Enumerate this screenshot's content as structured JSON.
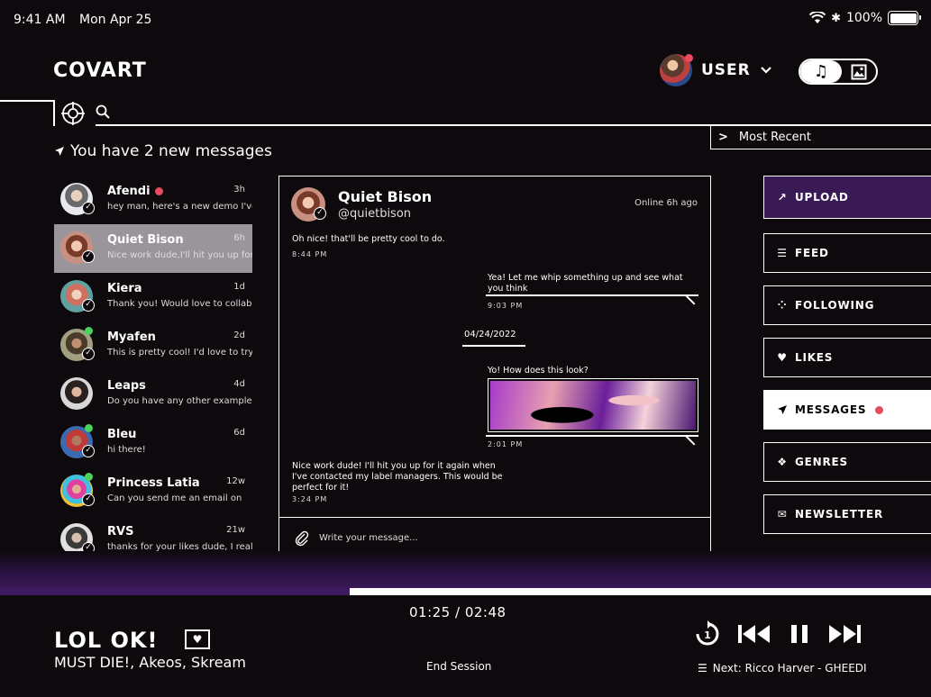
{
  "status_bar": {
    "time": "9:41 AM",
    "date": "Mon Apr 25",
    "battery": "100%"
  },
  "header": {
    "logo": "COVART",
    "user_label": "USER"
  },
  "search": {
    "placeholder": ""
  },
  "sort": {
    "label": "Most Recent"
  },
  "inbox": {
    "notice": "You have 2 new messages"
  },
  "conversations": [
    {
      "name": "Afendi",
      "time": "3h",
      "preview": "hey man, here's a new demo I've",
      "unread": true
    },
    {
      "name": "Quiet Bison",
      "time": "6h",
      "preview": "Nice work dude,I'll hit you up for",
      "active": true
    },
    {
      "name": "Kiera",
      "time": "1d",
      "preview": "Thank you! Would love to collab"
    },
    {
      "name": "Myafen",
      "time": "2d",
      "preview": "This is pretty cool! I'd love to try"
    },
    {
      "name": "Leaps",
      "time": "4d",
      "preview": "Do you have any other example"
    },
    {
      "name": "Bleu",
      "time": "6d",
      "preview": "hi there!"
    },
    {
      "name": "Princess Latia",
      "time": "12w",
      "preview": "Can you send me an email on"
    },
    {
      "name": "RVS",
      "time": "21w",
      "preview": "thanks for your likes dude, I real"
    }
  ],
  "chat": {
    "name": "Quiet Bison",
    "handle": "@quietbison",
    "online": "Online 6h ago",
    "messages": [
      {
        "text": "Oh nice! that'll be pretty cool to do.",
        "time": "8:44 PM"
      },
      {
        "text": "Yea! Let me whip something up and see what you think",
        "time": "9:03 PM"
      },
      {
        "date": "04/24/2022"
      },
      {
        "text": "Yo! How does this look?",
        "time": "2:01 PM"
      },
      {
        "text": "Nice work dude! I'll hit you up for it again when I've contacted my label managers. This would be perfect for it!",
        "time": "3:24 PM"
      }
    ],
    "compose_placeholder": "Write your message..."
  },
  "nav": {
    "upload": "UPLOAD",
    "feed": "FEED",
    "following": "FOLLOWING",
    "likes": "LIKES",
    "messages": "MESSAGES",
    "genres": "GENRES",
    "newsletter": "NEWSLETTER"
  },
  "player": {
    "title": "LOL OK!",
    "artist": "MUST DIE!, Akeos, Skream",
    "time": "01:25 / 02:48",
    "progress": 0.375,
    "end_session": "End Session",
    "next_up": "Next: Ricco Harver - GHEEDI"
  },
  "colors": {
    "accent_purple": "#3e1a60",
    "unread_red": "#e84a5f",
    "online_green": "#4ad25a"
  }
}
